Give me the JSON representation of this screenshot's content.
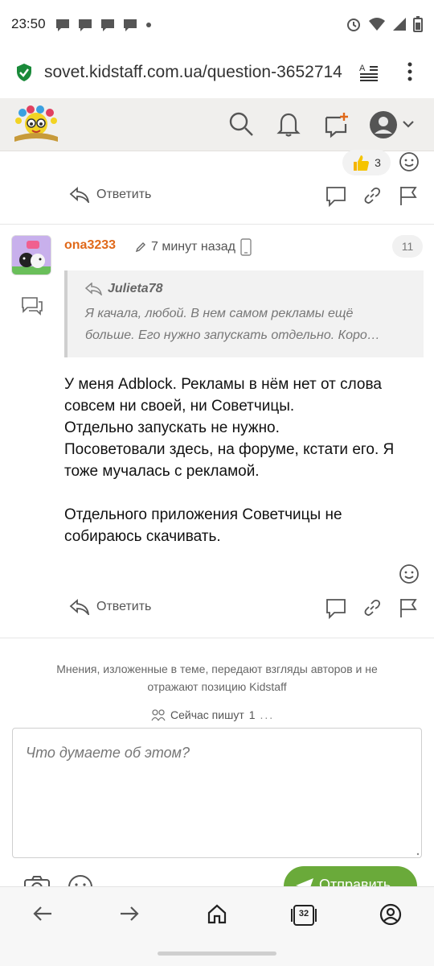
{
  "status_bar": {
    "time": "23:50"
  },
  "browser": {
    "url": "sovet.kidstaff.com.ua/question-3652714"
  },
  "header": {
    "logo_alt": "Kidstaff logo"
  },
  "previous_post": {
    "reaction_count": "3",
    "reply_label": "Ответить"
  },
  "post": {
    "author": "ona3233",
    "time": "7 минут назад",
    "number": "11",
    "quote": {
      "author": "Julieta78",
      "line1": "Я качала, любой. В нем самом рекламы ещё",
      "line2": "больше. Его нужно запускать отдельно. Коро…"
    },
    "body": {
      "p1": "У меня Adblock. Рекламы в нём нет от слова совсем ни своей, ни Советчицы.",
      "p2": "Отдельно запускать не нужно.",
      "p3": "Посоветовали здесь, на форуме, кстати его. Я тоже мучалась с рекламой.",
      "p4": "Отдельного приложения Советчицы не собираюсь скачивать."
    },
    "reply_label": "Ответить"
  },
  "footer": {
    "disclaimer": "Мнения, изложенные в теме, передают взгляды авторов и не отражают позицию Kidstaff",
    "typing_label": "Сейчас пишут",
    "typing_count": "1",
    "typing_dots": "..."
  },
  "composer": {
    "placeholder": "Что думаете об этом?",
    "send_label": "Отправить"
  },
  "bottom_nav": {
    "tabs_count": "32"
  },
  "colors": {
    "accent_orange": "#e0691a",
    "send_green": "#6aaa3a",
    "lock_green": "#1a8a3a"
  }
}
